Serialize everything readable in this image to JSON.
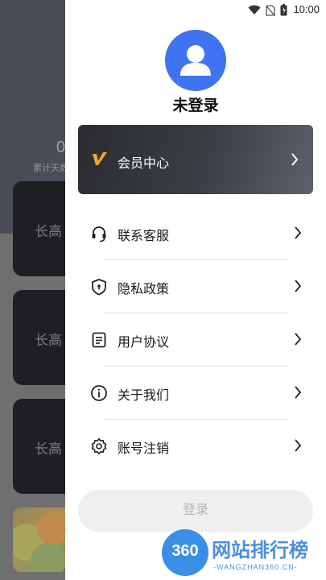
{
  "status_bar": {
    "time": "10:00"
  },
  "background": {
    "stat_value": "0",
    "stat_label": "累计天数",
    "cards": [
      "长高",
      "长高",
      "长高"
    ]
  },
  "profile": {
    "username": "未登录"
  },
  "vip": {
    "label": "会员中心",
    "logo_color": "#f5a623"
  },
  "menu": [
    {
      "label": "联系客服",
      "icon": "headset-icon"
    },
    {
      "label": "隐私政策",
      "icon": "shield-icon"
    },
    {
      "label": "用户协议",
      "icon": "document-icon"
    },
    {
      "label": "关于我们",
      "icon": "info-icon"
    },
    {
      "label": "账号注销",
      "icon": "gear-icon"
    }
  ],
  "login_button": {
    "label": "登录"
  },
  "watermark": {
    "logo_text": "360",
    "title": "网站排行榜",
    "url": "-WANGZHAN360.CN-"
  },
  "colors": {
    "accent": "#3f73f2",
    "drawer_bg": "#ffffff"
  }
}
